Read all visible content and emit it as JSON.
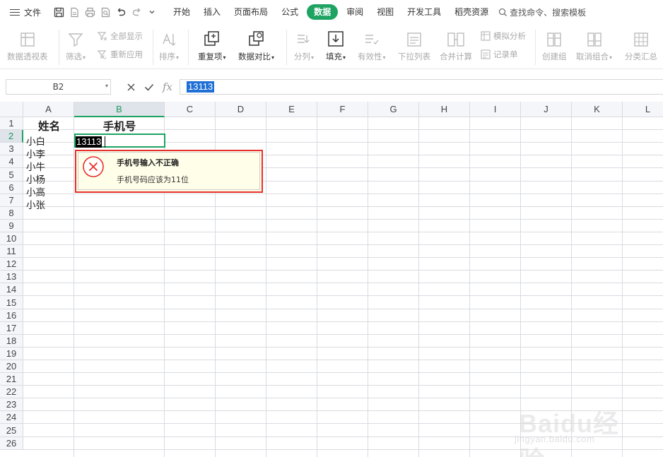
{
  "menubar": {
    "file_label": "文件",
    "tabs": [
      {
        "label": "开始"
      },
      {
        "label": "插入"
      },
      {
        "label": "页面布局"
      },
      {
        "label": "公式"
      },
      {
        "label": "数据",
        "active": true
      },
      {
        "label": "审阅"
      },
      {
        "label": "视图"
      },
      {
        "label": "开发工具"
      },
      {
        "label": "稻壳资源"
      }
    ],
    "search_label": "查找命令、搜索模板"
  },
  "ribbon": {
    "pivot": "数据透视表",
    "filter": "筛选",
    "show_all": "全部显示",
    "reapply": "重新应用",
    "sort": "排序",
    "duplicates": "重复项",
    "compare": "数据对比",
    "split": "分列",
    "fill": "填充",
    "validity": "有效性",
    "dropdown_list": "下拉列表",
    "consolidate": "合并计算",
    "what_if": "模拟分析",
    "record_form": "记录单",
    "group": "创建组",
    "ungroup": "取消组合",
    "subtotal": "分类汇总"
  },
  "formula_bar": {
    "name_box": "B2",
    "fx_label": "fx",
    "value": "13113"
  },
  "grid": {
    "columns": [
      "A",
      "B",
      "C",
      "D",
      "E",
      "F",
      "G",
      "H",
      "I",
      "J",
      "K",
      "L"
    ],
    "rows": [
      "1",
      "2",
      "3",
      "4",
      "5",
      "6",
      "7",
      "8",
      "9",
      "10",
      "11",
      "12",
      "13",
      "14",
      "15",
      "16",
      "17",
      "18",
      "19",
      "20",
      "21",
      "22",
      "23",
      "24",
      "25",
      "26"
    ],
    "selected_column": "B",
    "selected_row": "2",
    "header_name": "姓名",
    "header_phone": "手机号",
    "names": [
      "小白",
      "小李",
      "小牛",
      "小杨",
      "小高",
      "小张"
    ],
    "editing_value": "13113"
  },
  "validation_popup": {
    "title": "手机号输入不正确",
    "message": "手机号码应该为11位"
  },
  "watermark": {
    "logo": "Baidu经验",
    "url": "jingyan.baidu.com"
  },
  "colors": {
    "accent": "#1ea362",
    "error": "#e8302b",
    "popup_bg": "#fffee8",
    "selection": "#1f6fd6"
  }
}
